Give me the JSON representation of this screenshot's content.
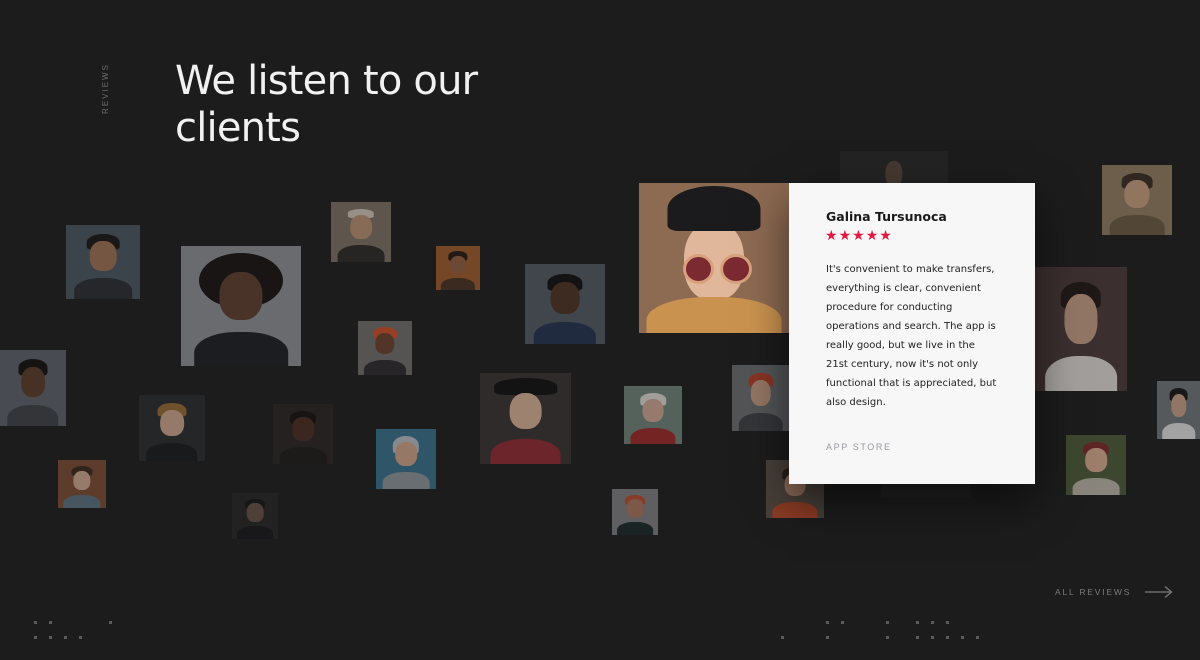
{
  "section": {
    "label": "REVIEWS",
    "title": "We listen to our clients"
  },
  "review": {
    "name": "Galina Tursunoca",
    "rating": 5,
    "star_glyph": "★",
    "text": "It's convenient to make transfers, everything is clear, convenient procedure for conducting operations and search. The app is really good, but we live in the 21st century, now it's not only functional that is appreciated, but also design.",
    "source": "APP STORE"
  },
  "footer": {
    "all_reviews_label": "ALL REVIEWS",
    "arrow_icon": "arrow-right-icon"
  },
  "colors": {
    "background": "#1c1c1d",
    "card": "#f7f7f8",
    "star": "#e3173f",
    "title": "#f1f1f1"
  }
}
